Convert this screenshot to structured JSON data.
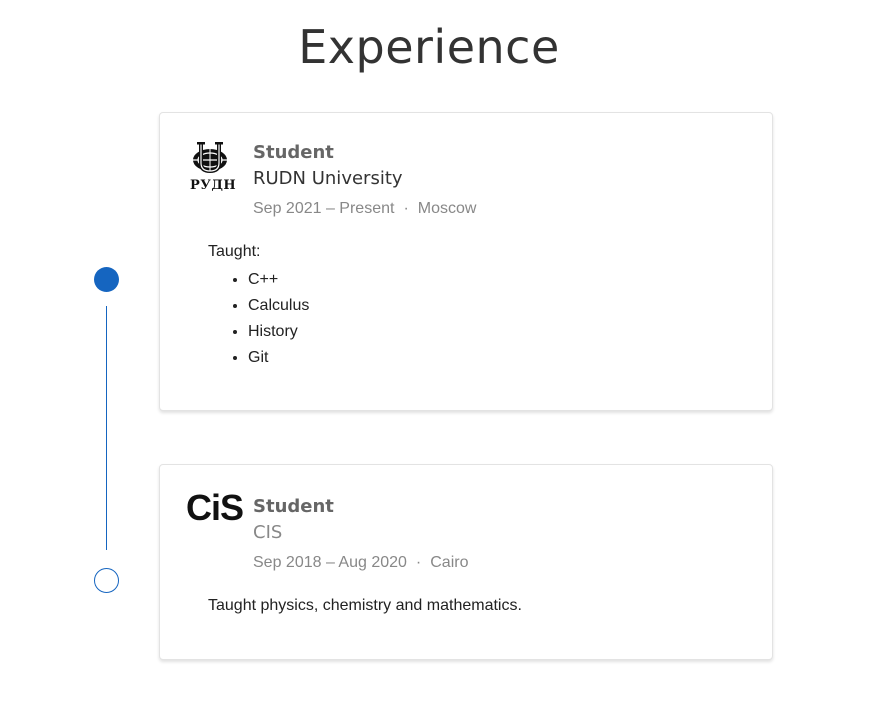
{
  "section": {
    "title": "Experience"
  },
  "entries": [
    {
      "role": "Student",
      "organization": "RUDN University",
      "period": "Sep 2021 – Present",
      "separator": "·",
      "location": "Moscow",
      "logo_text": "РУДН",
      "logo_icon": "rudn-university-logo",
      "description_intro": "Taught:",
      "items": [
        "C++",
        "Calculus",
        "History",
        "Git"
      ]
    },
    {
      "role": "Student",
      "organization": "CIS",
      "period": "Sep 2018 – Aug 2020",
      "separator": "·",
      "location": "Cairo",
      "logo_text": "CiS",
      "logo_icon": "cis-logo",
      "description": "Taught physics, chemistry and mathematics."
    }
  ],
  "colors": {
    "timeline": "#1565c0",
    "title": "#333333",
    "muted": "#888888"
  }
}
